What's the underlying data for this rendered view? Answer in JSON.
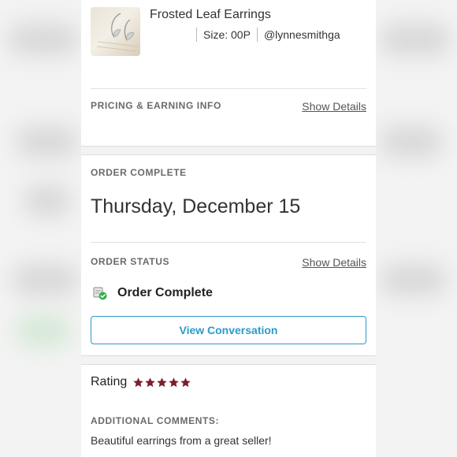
{
  "product": {
    "title": "Frosted Leaf Earrings",
    "size": "Size: 00P",
    "seller": "@lynnesmithga",
    "thumbnail_icon": "earrings-photo"
  },
  "pricing": {
    "label": "PRICING & EARNING INFO",
    "link": "Show Details"
  },
  "order": {
    "complete_label": "ORDER COMPLETE",
    "date": "Thursday, December 15",
    "status_label": "ORDER STATUS",
    "status_link": "Show Details",
    "status_icon": "package-check-icon",
    "status_text": "Order Complete",
    "conversation_button": "View Conversation"
  },
  "rating": {
    "label": "Rating",
    "stars": 5,
    "max_stars": 5
  },
  "comments": {
    "label": "ADDITIONAL COMMENTS:",
    "text": "Beautiful earrings from a great seller!"
  },
  "colors": {
    "accent": "#2d9ac7",
    "star": "#7a1f2b",
    "status_check": "#2fb34a"
  }
}
